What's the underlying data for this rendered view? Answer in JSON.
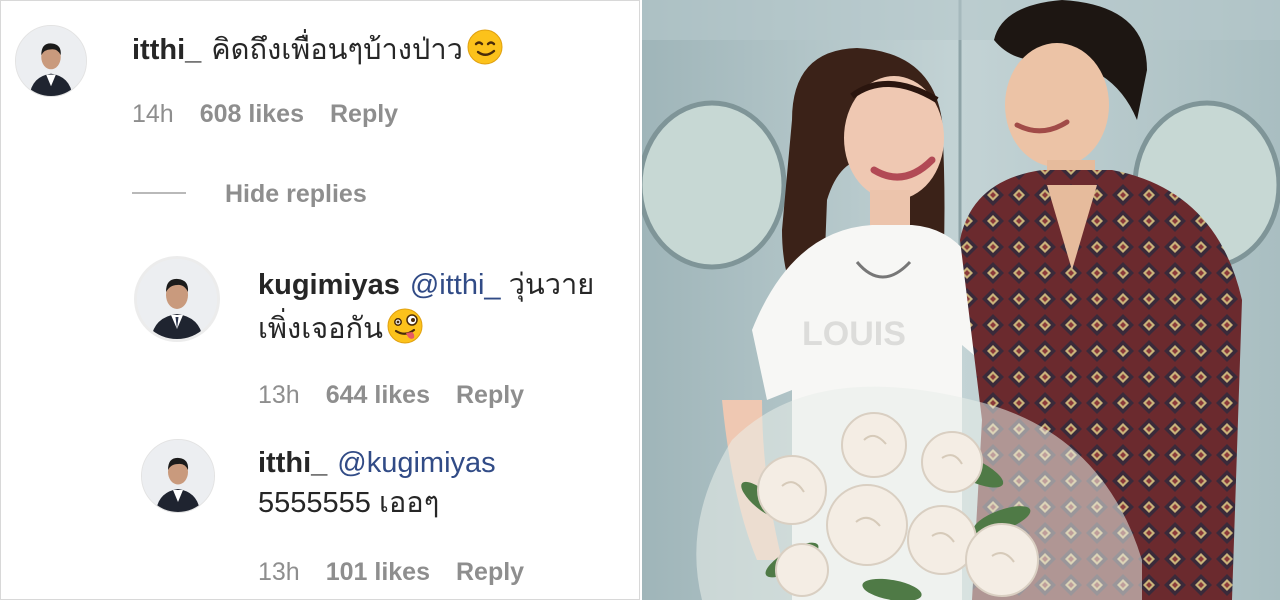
{
  "comments": [
    {
      "username": "itthi_",
      "text": "คิดถึงเพื่อนๆบ้างป่าว",
      "emoji": "smirk-emoji",
      "time": "14h",
      "likes": "608 likes",
      "reply_label": "Reply"
    }
  ],
  "hide_replies_label": "Hide replies",
  "replies": [
    {
      "username": "kugimiyas",
      "mention": "@itthi_",
      "text_line1": "วุ่นวาย",
      "text_line2": "เพิ่งเจอกัน",
      "emoji": "zany-face-emoji",
      "time": "13h",
      "likes": "644 likes",
      "reply_label": "Reply"
    },
    {
      "username": "itthi_",
      "mention": "@kugimiyas",
      "text_line2": "5555555 เออๆ",
      "time": "13h",
      "likes": "101 likes",
      "reply_label": "Reply"
    }
  ],
  "colors": {
    "text": "#262626",
    "meta": "#8e8e8e",
    "mention": "#314b86",
    "photo_wall": "#b7c9cc"
  }
}
